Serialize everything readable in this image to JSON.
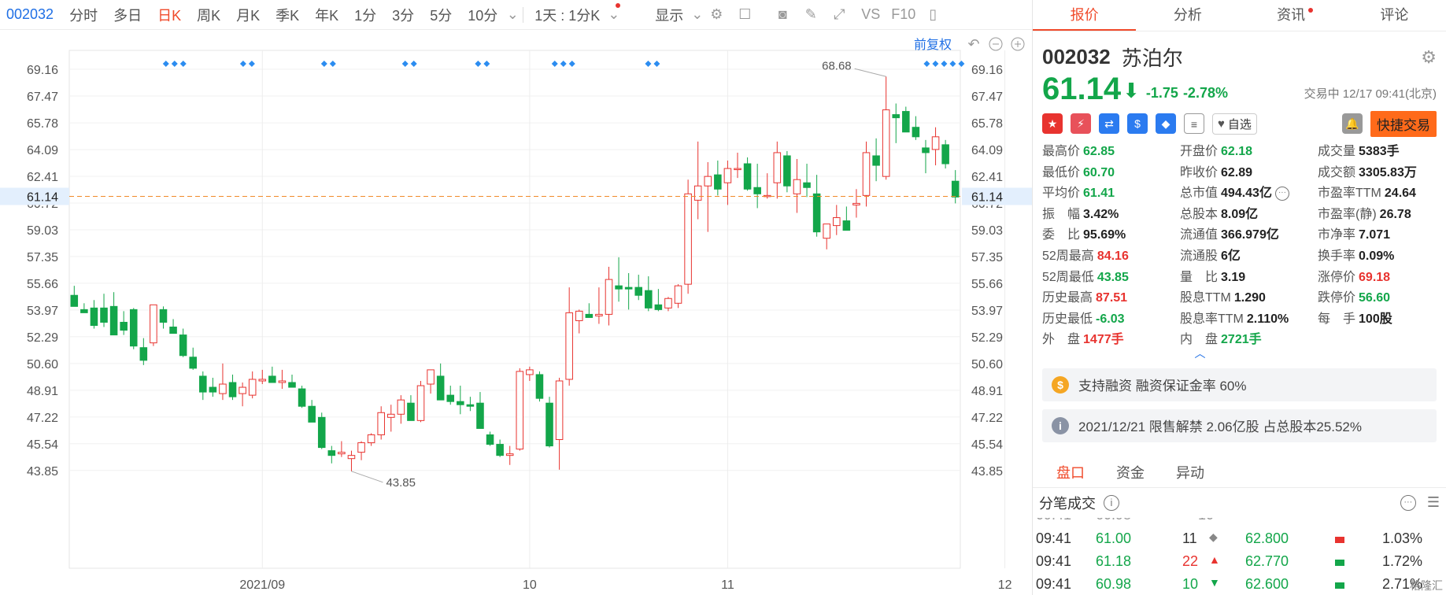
{
  "toolbar": {
    "code": "002032",
    "tabs": [
      "分时",
      "多日",
      "日K",
      "周K",
      "月K",
      "季K",
      "年K",
      "1分",
      "3分",
      "5分",
      "10分"
    ],
    "active_tab": "日K",
    "interval": "1天 : 1分K",
    "display": "显示",
    "tools": [
      "VS",
      "F10"
    ]
  },
  "chart": {
    "adjust_label": "前复权",
    "y_ticks": [
      "69.16",
      "67.47",
      "65.78",
      "64.09",
      "62.41",
      "60.72",
      "59.03",
      "57.35",
      "55.66",
      "53.97",
      "52.29",
      "50.60",
      "48.91",
      "47.22",
      "45.54",
      "43.85"
    ],
    "x_labels": [
      "2021/09",
      "10",
      "11",
      "12"
    ],
    "current_price_label": "61.14",
    "high_annotation": "68.68",
    "low_annotation": "43.85"
  },
  "chart_data": {
    "type": "candlestick",
    "ylim": [
      42.5,
      70.5
    ],
    "current": 61.14,
    "candles": [
      [
        54.9,
        55.5,
        54.3,
        54.2
      ],
      [
        54.0,
        54.4,
        53.9,
        53.8
      ],
      [
        54.1,
        54.6,
        52.8,
        53.0
      ],
      [
        54.1,
        55.0,
        52.9,
        53.2
      ],
      [
        54.2,
        55.1,
        52.4,
        52.4
      ],
      [
        53.2,
        53.9,
        52.4,
        52.7
      ],
      [
        54.0,
        54.1,
        51.5,
        51.7
      ],
      [
        51.6,
        52.2,
        50.5,
        50.8
      ],
      [
        51.9,
        54.3,
        51.7,
        54.3
      ],
      [
        54.0,
        54.2,
        52.8,
        53.2
      ],
      [
        52.9,
        53.4,
        52.6,
        52.5
      ],
      [
        52.4,
        52.8,
        51.0,
        51.1
      ],
      [
        51.0,
        51.6,
        50.2,
        50.3
      ],
      [
        49.8,
        50.1,
        48.3,
        48.8
      ],
      [
        49.1,
        49.7,
        48.5,
        48.8
      ],
      [
        48.7,
        50.6,
        48.3,
        49.3
      ],
      [
        49.4,
        49.9,
        48.3,
        48.5
      ],
      [
        48.7,
        49.4,
        47.9,
        49.1
      ],
      [
        48.6,
        50.1,
        48.4,
        49.6
      ],
      [
        49.5,
        50.2,
        49.3,
        49.6
      ],
      [
        49.8,
        50.4,
        49.4,
        49.4
      ],
      [
        49.4,
        50.2,
        49.0,
        49.5
      ],
      [
        49.4,
        49.9,
        49.2,
        49.1
      ],
      [
        49.0,
        49.2,
        47.8,
        47.9
      ],
      [
        47.9,
        48.3,
        46.9,
        46.9
      ],
      [
        47.2,
        47.5,
        45.2,
        45.3
      ],
      [
        45.1,
        45.4,
        44.3,
        44.8
      ],
      [
        44.9,
        45.7,
        44.7,
        45.0
      ],
      [
        44.6,
        45.1,
        43.8,
        44.8
      ],
      [
        45.0,
        45.7,
        44.5,
        45.6
      ],
      [
        45.6,
        46.2,
        45.4,
        46.1
      ],
      [
        46.1,
        47.9,
        45.8,
        47.5
      ],
      [
        47.2,
        48.0,
        46.3,
        47.4
      ],
      [
        47.4,
        48.6,
        46.8,
        48.3
      ],
      [
        48.1,
        48.6,
        47.0,
        47.0
      ],
      [
        47.0,
        49.5,
        46.9,
        49.2
      ],
      [
        49.3,
        50.2,
        48.7,
        50.2
      ],
      [
        49.8,
        50.6,
        49.2,
        48.3
      ],
      [
        48.6,
        49.2,
        48.0,
        48.2
      ],
      [
        48.2,
        49.2,
        47.4,
        48.0
      ],
      [
        48.0,
        48.5,
        47.6,
        47.9
      ],
      [
        48.1,
        48.8,
        46.8,
        46.5
      ],
      [
        46.1,
        46.3,
        45.4,
        45.5
      ],
      [
        45.5,
        45.8,
        44.7,
        44.8
      ],
      [
        44.8,
        45.4,
        44.2,
        44.9
      ],
      [
        45.2,
        50.3,
        45.1,
        50.1
      ],
      [
        49.9,
        50.4,
        49.5,
        50.2
      ],
      [
        49.9,
        50.1,
        48.2,
        48.4
      ],
      [
        48.1,
        48.5,
        45.3,
        45.4
      ],
      [
        45.8,
        49.7,
        43.9,
        49.5
      ],
      [
        49.6,
        55.4,
        49.2,
        53.8
      ],
      [
        53.3,
        54.0,
        52.5,
        53.9
      ],
      [
        53.7,
        54.4,
        53.5,
        53.5
      ],
      [
        53.6,
        55.4,
        53.1,
        53.7
      ],
      [
        53.7,
        56.7,
        53.0,
        55.9
      ],
      [
        55.5,
        57.3,
        54.5,
        55.3
      ],
      [
        55.4,
        56.3,
        54.0,
        55.3
      ],
      [
        55.4,
        56.2,
        54.6,
        54.9
      ],
      [
        55.2,
        56.1,
        53.9,
        54.1
      ],
      [
        54.3,
        55.3,
        53.9,
        54.0
      ],
      [
        54.1,
        54.8,
        53.9,
        54.7
      ],
      [
        54.4,
        55.6,
        54.1,
        55.5
      ],
      [
        55.6,
        62.2,
        55.0,
        61.3
      ],
      [
        60.9,
        64.6,
        59.7,
        61.8
      ],
      [
        61.8,
        63.3,
        58.9,
        62.4
      ],
      [
        62.5,
        63.4,
        61.2,
        61.6
      ],
      [
        62.0,
        63.4,
        60.6,
        62.9
      ],
      [
        62.9,
        63.9,
        62.3,
        62.9
      ],
      [
        63.2,
        63.6,
        61.5,
        61.6
      ],
      [
        61.7,
        63.2,
        60.4,
        61.3
      ],
      [
        61.2,
        62.6,
        61.0,
        61.2
      ],
      [
        62.0,
        64.6,
        61.0,
        63.9
      ],
      [
        63.7,
        64.0,
        61.4,
        61.8
      ],
      [
        61.3,
        63.5,
        60.1,
        62.2
      ],
      [
        62.0,
        63.2,
        61.1,
        61.7
      ],
      [
        61.3,
        62.5,
        58.6,
        58.9
      ],
      [
        58.5,
        59.4,
        57.8,
        59.4
      ],
      [
        59.3,
        60.6,
        58.7,
        59.8
      ],
      [
        59.6,
        60.5,
        59.0,
        59.0
      ],
      [
        60.6,
        61.6,
        59.8,
        60.7
      ],
      [
        61.2,
        64.6,
        60.5,
        63.9
      ],
      [
        63.7,
        64.8,
        62.1,
        63.1
      ],
      [
        62.4,
        68.7,
        62.2,
        66.6
      ],
      [
        66.3,
        67.0,
        64.5,
        66.1
      ],
      [
        66.5,
        66.8,
        65.3,
        65.2
      ],
      [
        65.5,
        66.2,
        64.7,
        64.9
      ],
      [
        64.2,
        64.7,
        62.6,
        63.9
      ],
      [
        64.1,
        65.5,
        63.1,
        64.9
      ],
      [
        64.4,
        64.7,
        62.9,
        63.2
      ],
      [
        62.1,
        62.8,
        60.7,
        61.1
      ]
    ]
  },
  "quote": {
    "tabs": [
      "报价",
      "分析",
      "资讯",
      "评论"
    ],
    "active_tab": "报价",
    "code": "002032",
    "name": "苏泊尔",
    "price": "61.14",
    "change": "-1.75",
    "change_pct": "-2.78%",
    "status": "交易中 12/17 09:41(北京)",
    "zixuan": "自选",
    "quick_trade": "快捷交易",
    "fields": [
      {
        "label": "最高价",
        "value": "62.85",
        "color": "g"
      },
      {
        "label": "开盘价",
        "value": "62.18",
        "color": "g"
      },
      {
        "label": "成交量",
        "value": "5383手",
        "color": "k"
      },
      {
        "label": "最低价",
        "value": "60.70",
        "color": "g"
      },
      {
        "label": "昨收价",
        "value": "62.89",
        "color": "k"
      },
      {
        "label": "成交额",
        "value": "3305.83万",
        "color": "k"
      },
      {
        "label": "平均价",
        "value": "61.41",
        "color": "g"
      },
      {
        "label": "总市值",
        "value": "494.43亿",
        "color": "k"
      },
      {
        "label": "市盈率TTM",
        "value": "24.64",
        "color": "k"
      },
      {
        "label": "振　幅",
        "value": "3.42%",
        "color": "k"
      },
      {
        "label": "总股本",
        "value": "8.09亿",
        "color": "k"
      },
      {
        "label": "市盈率(静)",
        "value": "26.78",
        "color": "k"
      },
      {
        "label": "委　比",
        "value": "95.69%",
        "color": "k"
      },
      {
        "label": "流通值",
        "value": "366.979亿",
        "color": "k"
      },
      {
        "label": "市净率",
        "value": "7.071",
        "color": "k"
      },
      {
        "label": "52周最高",
        "value": "84.16",
        "color": "r"
      },
      {
        "label": "流通股",
        "value": "6亿",
        "color": "k"
      },
      {
        "label": "换手率",
        "value": "0.09%",
        "color": "k"
      },
      {
        "label": "52周最低",
        "value": "43.85",
        "color": "g"
      },
      {
        "label": "量　比",
        "value": "3.19",
        "color": "k"
      },
      {
        "label": "涨停价",
        "value": "69.18",
        "color": "r"
      },
      {
        "label": "历史最高",
        "value": "87.51",
        "color": "r"
      },
      {
        "label": "股息TTM",
        "value": "1.290",
        "color": "k"
      },
      {
        "label": "跌停价",
        "value": "56.60",
        "color": "g"
      },
      {
        "label": "历史最低",
        "value": "-6.03",
        "color": "g"
      },
      {
        "label": "股息率TTM",
        "value": "2.110%",
        "color": "k"
      },
      {
        "label": "每　手",
        "value": "100股",
        "color": "k"
      },
      {
        "label": "外　盘",
        "value": "1477手",
        "color": "r"
      },
      {
        "label": "内　盘",
        "value": "2721手",
        "color": "g"
      }
    ],
    "banner1": "支持融资 融资保证金率 60%",
    "banner2": "2021/12/21  限售解禁 2.06亿股 占总股本25.52%",
    "sub_tabs": [
      "盘口",
      "资金",
      "异动"
    ],
    "ticks_title": "分笔成交",
    "ticks": [
      {
        "time": "09:41",
        "price": "61.00",
        "vol": "11",
        "dir": "◆",
        "bid": "62.800",
        "pct": "1.03%"
      },
      {
        "time": "09:41",
        "price": "61.18",
        "vol": "22",
        "dir": "▲",
        "bid": "62.770",
        "pct": "1.72%"
      },
      {
        "time": "09:41",
        "price": "60.98",
        "vol": "10",
        "dir": "▼",
        "bid": "62.600",
        "pct": "2.71%"
      }
    ],
    "watermark": "格隆汇"
  },
  "colors": {
    "up": "#e8332f",
    "down": "#13a64a",
    "accent": "#f04a2a",
    "link": "#1f6fe5"
  }
}
